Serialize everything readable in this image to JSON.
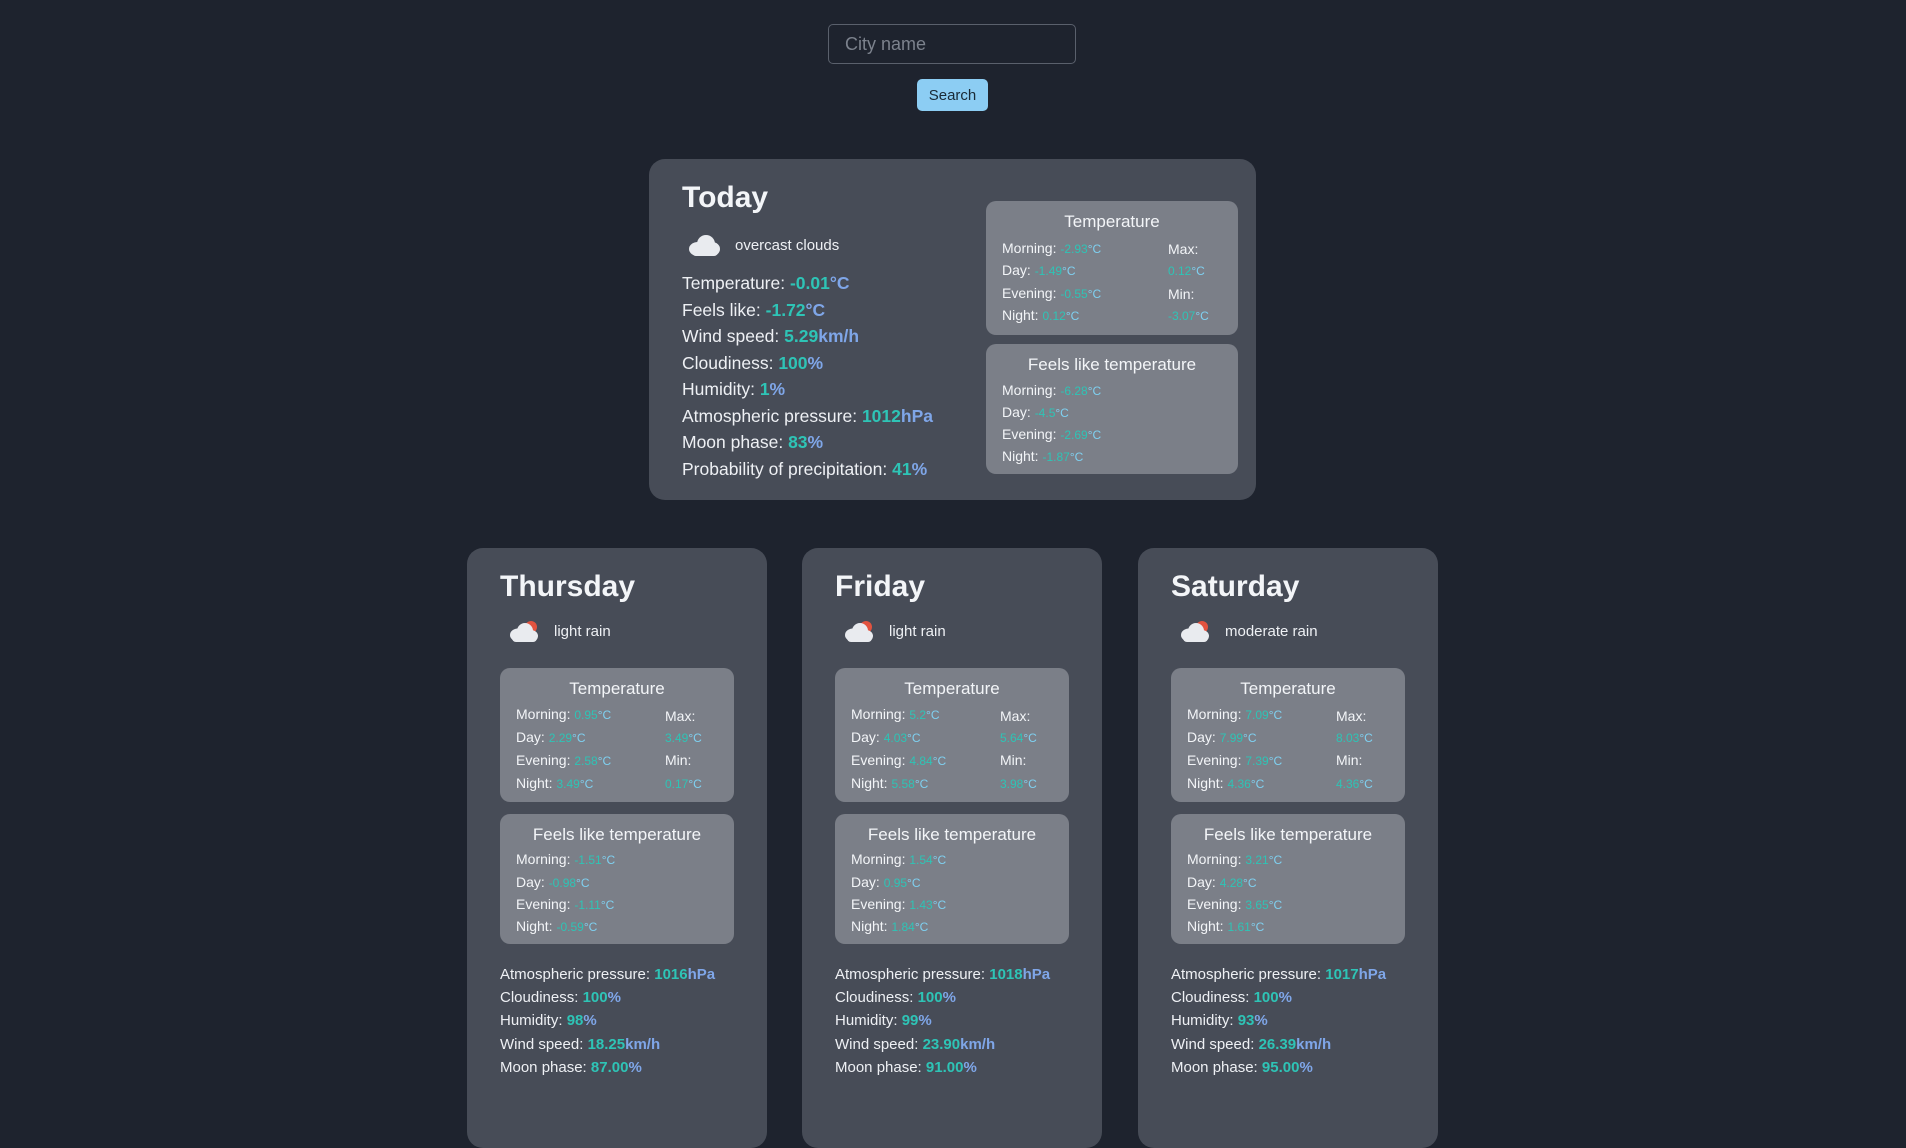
{
  "search": {
    "placeholder": "City name",
    "button_label": "Search"
  },
  "today": {
    "title": "Today",
    "icon": "cloud-icon",
    "description": "overcast clouds",
    "stats": [
      {
        "label": "Temperature:",
        "value": "-0.01",
        "unit": "°C"
      },
      {
        "label": "Feels like:",
        "value": "-1.72",
        "unit": "°C"
      },
      {
        "label": "Wind speed:",
        "value": "5.29",
        "unit": "km/h"
      },
      {
        "label": "Cloudiness:",
        "value": "100",
        "unit": "%"
      },
      {
        "label": "Humidity:",
        "value": "1",
        "unit": "%"
      },
      {
        "label": "Atmospheric pressure:",
        "value": "1012",
        "unit": "hPa"
      },
      {
        "label": "Moon phase:",
        "value": "83",
        "unit": "%"
      },
      {
        "label": "Probability of precipitation:",
        "value": "41",
        "unit": "%"
      }
    ],
    "temperature": {
      "title": "Temperature",
      "morning": "-2.93",
      "day": "-1.49",
      "evening": "-0.55",
      "night": "0.12",
      "max": "0.12",
      "min": "-3.07"
    },
    "feels_like": {
      "title": "Feels like temperature",
      "morning": "-6.28",
      "day": "-4.5",
      "evening": "-2.69",
      "night": "-1.87"
    }
  },
  "labels": {
    "morning": "Morning:",
    "day": "Day:",
    "evening": "Evening:",
    "night": "Night:",
    "max": "Max:",
    "min": "Min:",
    "unit_c": "°C"
  },
  "days": [
    {
      "title": "Thursday",
      "icon": "cloud-rain-sun-icon",
      "description": "light rain",
      "temperature": {
        "title": "Temperature",
        "morning": "0.95",
        "day": "2.29",
        "evening": "2.58",
        "night": "3.49",
        "max": "3.49",
        "min": "0.17"
      },
      "feels_like": {
        "title": "Feels like temperature",
        "morning": "-1.51",
        "day": "-0.98",
        "evening": "-1.11",
        "night": "-0.59"
      },
      "stats": [
        {
          "label": "Atmospheric pressure:",
          "value": "1016",
          "unit": "hPa"
        },
        {
          "label": "Cloudiness:",
          "value": "100",
          "unit": "%"
        },
        {
          "label": "Humidity:",
          "value": "98",
          "unit": "%"
        },
        {
          "label": "Wind speed:",
          "value": "18.25",
          "unit": "km/h"
        },
        {
          "label": "Moon phase:",
          "value": "87.00",
          "unit": "%"
        }
      ]
    },
    {
      "title": "Friday",
      "icon": "cloud-rain-sun-icon",
      "description": "light rain",
      "temperature": {
        "title": "Temperature",
        "morning": "5.2",
        "day": "4.03",
        "evening": "4.84",
        "night": "5.58",
        "max": "5.64",
        "min": "3.98"
      },
      "feels_like": {
        "title": "Feels like temperature",
        "morning": "1.54",
        "day": "0.95",
        "evening": "1.43",
        "night": "1.84"
      },
      "stats": [
        {
          "label": "Atmospheric pressure:",
          "value": "1018",
          "unit": "hPa"
        },
        {
          "label": "Cloudiness:",
          "value": "100",
          "unit": "%"
        },
        {
          "label": "Humidity:",
          "value": "99",
          "unit": "%"
        },
        {
          "label": "Wind speed:",
          "value": "23.90",
          "unit": "km/h"
        },
        {
          "label": "Moon phase:",
          "value": "91.00",
          "unit": "%"
        }
      ]
    },
    {
      "title": "Saturday",
      "icon": "cloud-rain-sun-icon",
      "description": "moderate rain",
      "temperature": {
        "title": "Temperature",
        "morning": "7.09",
        "day": "7.99",
        "evening": "7.39",
        "night": "4.36",
        "max": "8.03",
        "min": "4.36"
      },
      "feels_like": {
        "title": "Feels like temperature",
        "morning": "3.21",
        "day": "4.28",
        "evening": "3.65",
        "night": "1.61"
      },
      "stats": [
        {
          "label": "Atmospheric pressure:",
          "value": "1017",
          "unit": "hPa"
        },
        {
          "label": "Cloudiness:",
          "value": "100",
          "unit": "%"
        },
        {
          "label": "Humidity:",
          "value": "93",
          "unit": "%"
        },
        {
          "label": "Wind speed:",
          "value": "26.39",
          "unit": "km/h"
        },
        {
          "label": "Moon phase:",
          "value": "95.00",
          "unit": "%"
        }
      ]
    }
  ]
}
